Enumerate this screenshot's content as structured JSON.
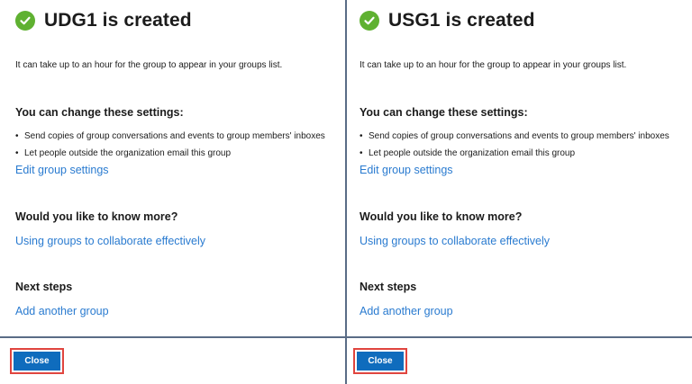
{
  "panels": [
    {
      "title": "UDG1 is created",
      "info": "It can take up to an hour for the group to appear in your groups list.",
      "settings_heading": "You can change these settings:",
      "settings": [
        "Send copies of group conversations and events to group members' inboxes",
        "Let people outside the organization email this group"
      ],
      "edit_link": "Edit group settings",
      "more_heading": "Would you like to know more?",
      "more_link": "Using groups to collaborate effectively",
      "next_heading": "Next steps",
      "next_link": "Add another group",
      "close_label": "Close"
    },
    {
      "title": "USG1 is created",
      "info": "It can take up to an hour for the group to appear in your groups list.",
      "settings_heading": "You can change these settings:",
      "settings": [
        "Send copies of group conversations and events to group members' inboxes",
        "Let people outside the organization email this group"
      ],
      "edit_link": "Edit group settings",
      "more_heading": "Would you like to know more?",
      "more_link": "Using groups to collaborate effectively",
      "next_heading": "Next steps",
      "next_link": "Add another group",
      "close_label": "Close"
    }
  ],
  "icons": {
    "success": "check-circle-icon"
  },
  "colors": {
    "success": "#5fb131",
    "link": "#2a7bd0",
    "primary": "#0f6cbd",
    "highlight": "#e0453f"
  }
}
